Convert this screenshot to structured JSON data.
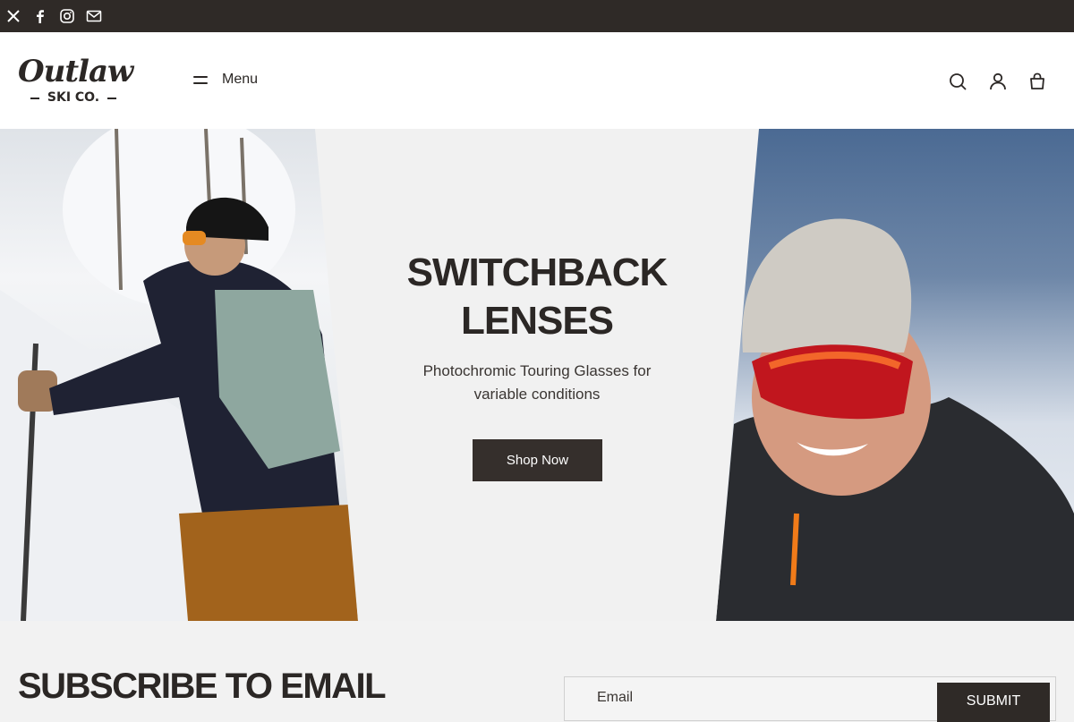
{
  "social": {
    "icons": [
      "x-icon",
      "facebook-icon",
      "instagram-icon",
      "email-icon"
    ]
  },
  "header": {
    "logo_script": "Outlaw",
    "logo_sub": "SKI CO.",
    "menu_label": "Menu",
    "icons": [
      "search-icon",
      "account-icon",
      "cart-icon"
    ]
  },
  "hero": {
    "title_line1": "SWITCHBACK",
    "title_line2": "LENSES",
    "subtitle_line1": "Photochromic Touring Glasses for",
    "subtitle_line2": "variable conditions",
    "cta_label": "Shop Now"
  },
  "subscribe": {
    "title": "SUBSCRIBE TO EMAIL",
    "email_placeholder": "Email",
    "submit_label": "SUBMIT"
  },
  "colors": {
    "dark": "#2f2a27",
    "text": "#2b2725",
    "background": "#f2f2f2",
    "white": "#ffffff"
  }
}
